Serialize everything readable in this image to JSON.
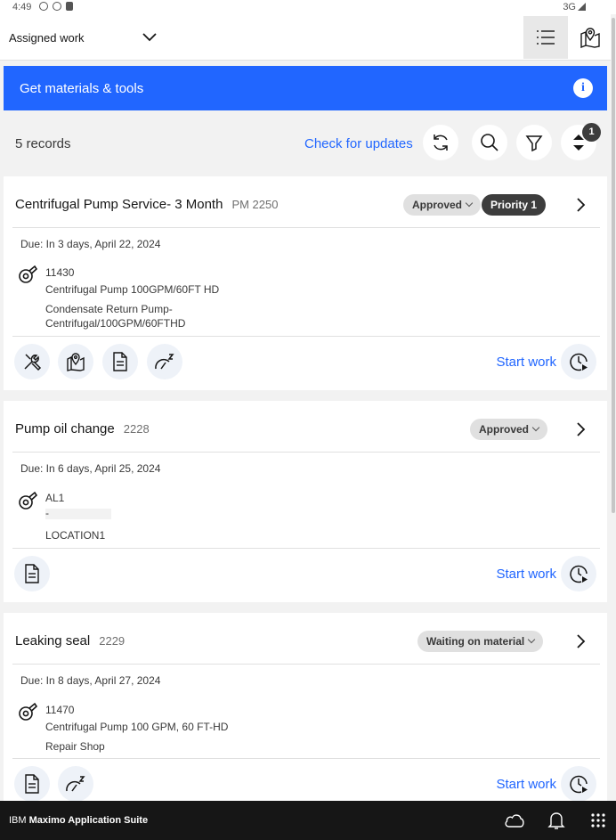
{
  "status_bar": {
    "time": "4:49",
    "network": "3G"
  },
  "header": {
    "title": "Assigned work"
  },
  "banner": {
    "text": "Get materials & tools"
  },
  "toolbar": {
    "record_count": "5 records",
    "check_updates": "Check for updates",
    "sort_badge": "1"
  },
  "work_orders": [
    {
      "title": "Centrifugal Pump Service- 3 Month",
      "number": "PM 2250",
      "status": "Approved",
      "priority": "Priority 1",
      "due": "Due: In 3 days, April 22, 2024",
      "asset_num": "11430",
      "asset_desc": "Centrifugal Pump 100GPM/60FT HD",
      "location_line1": "Condensate Return Pump-",
      "location_line2": "Centrifugal/100GPM/60FTHD",
      "start_label": "Start work"
    },
    {
      "title": "Pump oil change",
      "number": "2228",
      "status": "Approved",
      "due": "Due: In 6 days, April 25, 2024",
      "asset_num": "AL1",
      "asset_desc": "-",
      "location": "LOCATION1",
      "start_label": "Start work"
    },
    {
      "title": "Leaking seal",
      "number": "2229",
      "status": "Waiting on material",
      "due": "Due: In 8 days, April 27, 2024",
      "asset_num": "11470",
      "asset_desc": "Centrifugal Pump 100 GPM, 60 FT-HD",
      "location": "Repair Shop",
      "start_label": "Start work"
    }
  ],
  "footer": {
    "brand_prefix": "IBM",
    "brand_name": "Maximo Application Suite"
  },
  "colors": {
    "accent": "#2166ff",
    "footer_bg": "#161616",
    "tag_bg": "#e0e0e0",
    "priority_bg": "#3d3d3d"
  },
  "icons": [
    "list-icon",
    "map-pin-icon",
    "info-icon",
    "refresh-icon",
    "search-icon",
    "filter-icon",
    "sort-icon",
    "chevron-right-icon",
    "asset-icon",
    "tools-icon",
    "map-icon",
    "document-icon",
    "meter-icon",
    "timer-play-icon",
    "cloud-icon",
    "bell-icon",
    "app-grid-icon"
  ]
}
